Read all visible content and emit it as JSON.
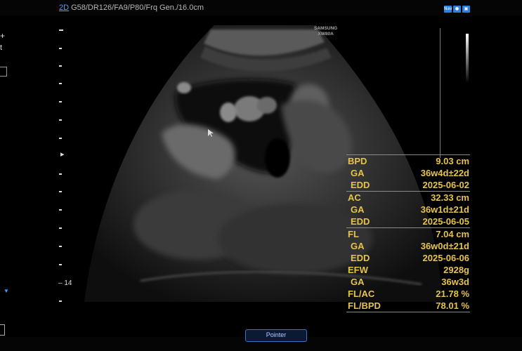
{
  "header": {
    "mode": "2D",
    "params": "G58/DR126/FA9/P80/Frq Gen./16.0cm"
  },
  "top_icons": [
    "Nav",
    "probe-icon",
    "image-icon"
  ],
  "left_panel": {
    "plus": "+",
    "t": "t"
  },
  "brand": {
    "line1": "SAMSUNG",
    "line2": "XW80A"
  },
  "depth_scale": {
    "label": "14"
  },
  "measurements": {
    "bpd": {
      "label": "BPD",
      "value": "9.03 cm"
    },
    "bpd_ga": {
      "label": "GA",
      "value": "36w4d±22d"
    },
    "bpd_edd": {
      "label": "EDD",
      "value": "2025-06-02"
    },
    "ac": {
      "label": "AC",
      "value": "32.33 cm"
    },
    "ac_ga": {
      "label": "GA",
      "value": "36w1d±21d"
    },
    "ac_edd": {
      "label": "EDD",
      "value": "2025-06-05"
    },
    "fl": {
      "label": "FL",
      "value": "7.04 cm"
    },
    "fl_ga": {
      "label": "GA",
      "value": "36w0d±21d"
    },
    "fl_edd": {
      "label": "EDD",
      "value": "2025-06-06"
    },
    "efw": {
      "label": "EFW",
      "value": "2928g"
    },
    "efw_ga": {
      "label": "GA",
      "value": "36w3d"
    },
    "fl_ac": {
      "label": "FL/AC",
      "value": "21.78 %"
    },
    "fl_bpd": {
      "label": "FL/BPD",
      "value": "78.01 %"
    }
  },
  "bottom": {
    "pointer_label": "Pointer"
  },
  "colors": {
    "accent": "#2f7fe0",
    "measure_text": "#e6c44a",
    "mode_link": "#4aa3ff"
  }
}
